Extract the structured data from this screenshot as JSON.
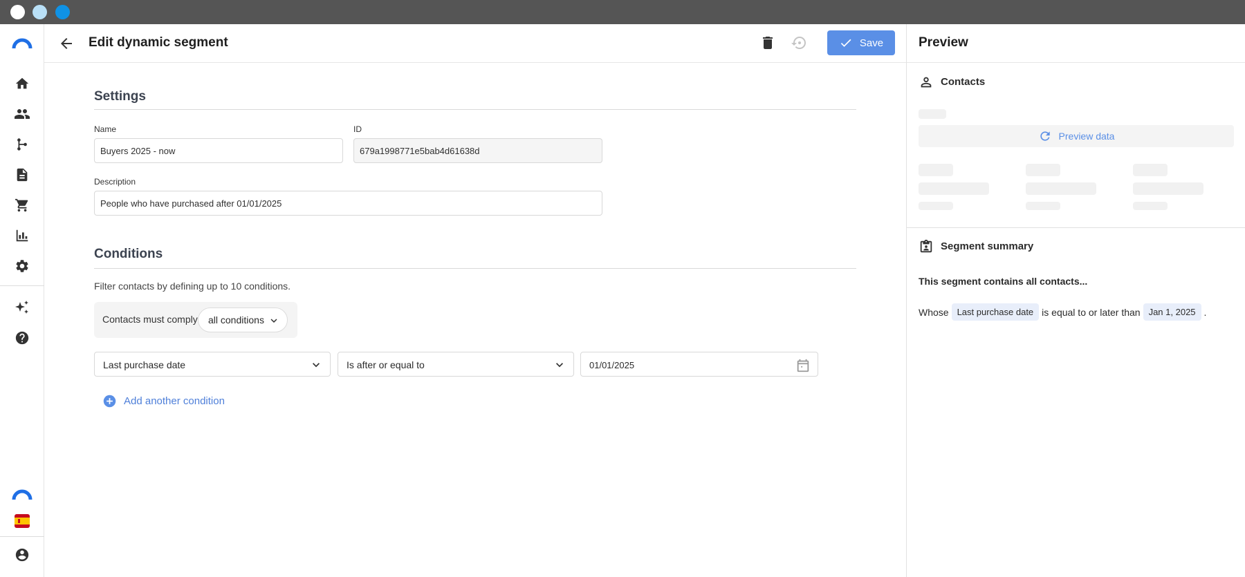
{
  "colors": {
    "accent": "#5a8fe6",
    "link": "#4e7fd9",
    "titlebar": "#555555"
  },
  "sidebar": {
    "logo_icon": "brand-arc-icon",
    "items": [
      {
        "icon": "home-icon"
      },
      {
        "icon": "contacts-icon"
      },
      {
        "icon": "automation-icon"
      },
      {
        "icon": "document-icon"
      },
      {
        "icon": "cart-icon"
      },
      {
        "icon": "reports-icon"
      },
      {
        "icon": "settings-icon"
      },
      {
        "icon": "sparkle-icon"
      },
      {
        "icon": "help-icon"
      }
    ],
    "bottom": [
      {
        "icon": "brand-arc-icon"
      },
      {
        "icon": "spain-flag-icon"
      },
      {
        "icon": "account-icon"
      }
    ]
  },
  "header": {
    "title": "Edit dynamic segment",
    "save_label": "Save"
  },
  "settings": {
    "title": "Settings",
    "name_label": "Name",
    "name_value": "Buyers 2025 - now",
    "id_label": "ID",
    "id_value": "679a1998771e5bab4d61638d",
    "description_label": "Description",
    "description_value": "People who have purchased after 01/01/2025"
  },
  "conditions": {
    "title": "Conditions",
    "helper": "Filter contacts by defining up to 10 conditions.",
    "comply_label": "Contacts must comply:",
    "comply_value": "all conditions",
    "rows": [
      {
        "field": "Last purchase date",
        "operator": "Is after or equal to",
        "value": "01/01/2025"
      }
    ],
    "add_label": "Add another condition"
  },
  "preview": {
    "title": "Preview",
    "contacts_title": "Contacts",
    "preview_button": "Preview data",
    "summary_title": "Segment summary",
    "summary_intro": "This segment contains all contacts...",
    "summary_whose": "Whose",
    "summary_field": "Last purchase date",
    "summary_op": "is equal to or later than",
    "summary_value": "Jan 1, 2025",
    "summary_end": "."
  }
}
